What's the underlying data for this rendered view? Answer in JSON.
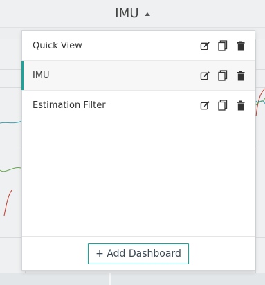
{
  "header": {
    "title": "IMU"
  },
  "menu": {
    "items": [
      {
        "label": "Quick View",
        "active": false
      },
      {
        "label": "IMU",
        "active": true
      },
      {
        "label": "Estimation Filter",
        "active": false
      }
    ],
    "add_button_label": "+ Add Dashboard"
  },
  "icons": {
    "edit": "edit-icon",
    "copy": "copy-icon",
    "delete": "trash-icon",
    "caret": "caret-up-icon"
  },
  "colors": {
    "accent": "#1aa39a",
    "text": "#333333",
    "icon": "#333333"
  }
}
